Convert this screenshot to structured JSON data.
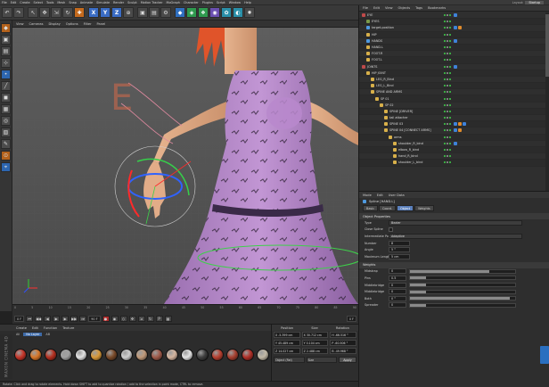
{
  "menubar": {
    "items": [
      "File",
      "Edit",
      "Create",
      "Select",
      "Tools",
      "Mesh",
      "Snap",
      "Animate",
      "Simulate",
      "Render",
      "Sculpt",
      "Motion Tracker",
      "MoGraph",
      "Character",
      "Plugins",
      "Script",
      "Window",
      "Help"
    ],
    "layout_label": "Layout:",
    "layout_value": "Startup"
  },
  "toolbar": {
    "icons": [
      {
        "name": "undo-icon",
        "glyph": "↶",
        "tone": ""
      },
      {
        "name": "redo-icon",
        "glyph": "↷",
        "tone": ""
      },
      {
        "name": "live-selection-icon",
        "glyph": "↖",
        "tone": "sep"
      },
      {
        "name": "move-icon",
        "glyph": "✥",
        "tone": ""
      },
      {
        "name": "scale-icon",
        "glyph": "⇲",
        "tone": ""
      },
      {
        "name": "rotate-icon",
        "glyph": "↻",
        "tone": ""
      },
      {
        "name": "recent-tools-icon",
        "glyph": "✚",
        "tone": "org"
      },
      {
        "name": "x-axis-icon",
        "glyph": "X",
        "tone": "xyz sep"
      },
      {
        "name": "y-axis-icon",
        "glyph": "Y",
        "tone": "xyz"
      },
      {
        "name": "z-axis-icon",
        "glyph": "Z",
        "tone": "xyz"
      },
      {
        "name": "coordinate-system-icon",
        "glyph": "⊕",
        "tone": ""
      },
      {
        "name": "render-view-icon",
        "glyph": "▣",
        "tone": "sep"
      },
      {
        "name": "render-picture-viewer-icon",
        "glyph": "▤",
        "tone": ""
      },
      {
        "name": "render-settings-icon",
        "glyph": "⚙",
        "tone": ""
      },
      {
        "name": "cube-icon",
        "glyph": "◆",
        "tone": "blu sep"
      },
      {
        "name": "subdivision-icon",
        "glyph": "◈",
        "tone": "grn"
      },
      {
        "name": "array-icon",
        "glyph": "❖",
        "tone": "grn"
      },
      {
        "name": "deformer-icon",
        "glyph": "◉",
        "tone": "pur"
      },
      {
        "name": "scene-icon",
        "glyph": "✿",
        "tone": "cyn"
      },
      {
        "name": "camera-icon",
        "glyph": "◐",
        "tone": "cyn"
      },
      {
        "name": "light-icon",
        "glyph": "✹",
        "tone": ""
      }
    ]
  },
  "lefttools": [
    "make-editable-icon",
    "model-mode-icon",
    "texture-mode-icon",
    "axis-mode-icon",
    "points-mode-icon",
    "edges-mode-icon",
    "polygons-mode-icon",
    "workplane-icon",
    "snap-icon",
    "locked-workplane-icon",
    "tweak-icon",
    "enable-axis-icon",
    "magnet-icon"
  ],
  "viewport": {
    "menu": [
      "View",
      "Cameras",
      "Display",
      "Options",
      "Filter",
      "Panel"
    ],
    "label": "E"
  },
  "timeline": {
    "ticks": [
      "0",
      "5",
      "10",
      "15",
      "20",
      "25",
      "30",
      "35",
      "40",
      "45",
      "50",
      "55",
      "60",
      "65",
      "70",
      "75",
      "80",
      "85",
      "90"
    ],
    "start_field": "0 F",
    "end_field": "90 F",
    "current_field": "0 F"
  },
  "materials": {
    "menu": [
      "Create",
      "Edit",
      "Function",
      "Texture"
    ],
    "layer_all": "All",
    "layer_no": "No Layer",
    "layer_ab": "AB",
    "swatches": [
      "#c7362a",
      "#d8772a",
      "#b53020",
      "#a3a3a3",
      "#e2e2e2",
      "#d99a3a",
      "#7a4b2a",
      "#cfcfcf",
      "#c09a7a",
      "#a05a4a",
      "#d6b6a0",
      "#e4e4e4",
      "#404040",
      "#b84030",
      "#a84030",
      "#b03028",
      "#c2b9a6",
      "#a55b3b"
    ]
  },
  "maxon_label": "MAXON CINEMA 4D",
  "coords": {
    "headers": [
      "Position",
      "Size",
      "Rotation"
    ],
    "rows": [
      [
        "X  -5.399 cm",
        "X  30.712 cm",
        "H  -66.516 °"
      ],
      [
        "Y  45.489 cm",
        "Y  0.104 cm",
        "P  -60.506 °"
      ],
      [
        "Z  14.027 cm",
        "Z  2.488 cm",
        "B  -49.968 °"
      ]
    ],
    "mode": "Object (Rel)",
    "size_mode": "Size",
    "apply": "Apply"
  },
  "status": "Rotate: Click and drag to rotate elements. Hold down SHIFT to add to quantize rotation / add to the selection in point mode, CTRL to remove.",
  "objects": {
    "menu": [
      "File",
      "Edit",
      "View",
      "Objects",
      "Tags",
      "Bookmarks"
    ],
    "rows": [
      {
        "name": "EYE",
        "indent": 0,
        "icon": "x",
        "tags": 1
      },
      {
        "name": "EYES",
        "indent": 1,
        "icon": "",
        "tags": 0
      },
      {
        "name": "target-position",
        "indent": 1,
        "icon": "n",
        "tags": 2
      },
      {
        "name": "HIP",
        "indent": 1,
        "icon": "j",
        "tags": 0
      },
      {
        "name": "HANDS",
        "indent": 1,
        "icon": "n",
        "tags": 1
      },
      {
        "name": "HAND.L",
        "indent": 1,
        "icon": "j",
        "tags": 0
      },
      {
        "name": "FOOT.R",
        "indent": 1,
        "icon": "j",
        "tags": 0
      },
      {
        "name": "FOOT.L",
        "indent": 1,
        "icon": "j",
        "tags": 0
      },
      {
        "name": "JOINTS",
        "indent": 0,
        "icon": "x",
        "tags": 1
      },
      {
        "name": "HIP JOINT",
        "indent": 1,
        "icon": "j",
        "tags": 0
      },
      {
        "name": "LEG_R_Bind",
        "indent": 2,
        "icon": "j",
        "tags": 0
      },
      {
        "name": "LEG_L_Bind",
        "indent": 2,
        "icon": "j",
        "tags": 0
      },
      {
        "name": "SPINE AND ARMS",
        "indent": 2,
        "icon": "j",
        "tags": 0
      },
      {
        "name": "SP 01",
        "indent": 3,
        "icon": "j",
        "tags": 0
      },
      {
        "name": "SP 02",
        "indent": 4,
        "icon": "j",
        "tags": 0
      },
      {
        "name": "SPINE [DRIVER]",
        "indent": 5,
        "icon": "j",
        "tags": 0
      },
      {
        "name": "tail attacher",
        "indent": 5,
        "icon": "j",
        "tags": 0
      },
      {
        "name": "SPINE 03",
        "indent": 5,
        "icon": "j",
        "tags": 3
      },
      {
        "name": "SPINE 04 [CONNECT ARMS]",
        "indent": 5,
        "icon": "j",
        "tags": 2
      },
      {
        "name": "arms",
        "indent": 6,
        "icon": "j",
        "tags": 0
      },
      {
        "name": "shoulder_R_bind",
        "indent": 7,
        "icon": "j",
        "tags": 1
      },
      {
        "name": "elbow_R_bind",
        "indent": 7,
        "icon": "j",
        "tags": 0
      },
      {
        "name": "hand_R_bind",
        "indent": 7,
        "icon": "j",
        "tags": 0
      },
      {
        "name": "shoulder_L_bind",
        "indent": 7,
        "icon": "j",
        "tags": 0
      }
    ]
  },
  "attributes": {
    "menu": [
      "Mode",
      "Edit",
      "User Data"
    ],
    "title": "Spline [HAND.L]",
    "tabs": [
      "Basic",
      "Coord.",
      "Object",
      "Weights"
    ],
    "active_tab": "Object",
    "section_object": "Object Properties",
    "props": [
      {
        "label": "Type",
        "value": "Bezier"
      },
      {
        "label": "Close Spline",
        "value": ""
      },
      {
        "label": "Intermediate Points",
        "value": "Adaptive"
      },
      {
        "label": "Number",
        "value": "8"
      },
      {
        "label": "Angle",
        "value": "5 °"
      },
      {
        "label": "Maximum Length",
        "value": "5 cm"
      }
    ],
    "section_weights": "Weights",
    "weights": [
      {
        "label": "Midstrap",
        "value": "0",
        "fill": 0.75
      },
      {
        "label": "Pins",
        "value": "0.5",
        "fill": 0.15
      },
      {
        "label": "Middlebridge",
        "value": "0",
        "fill": 0.15
      },
      {
        "label": "Middlebridge",
        "value": "0",
        "fill": 0.15
      },
      {
        "label": "Both",
        "value": "0 °",
        "fill": 0.95
      },
      {
        "label": "Spreader",
        "value": "0",
        "fill": 0.15
      }
    ]
  }
}
